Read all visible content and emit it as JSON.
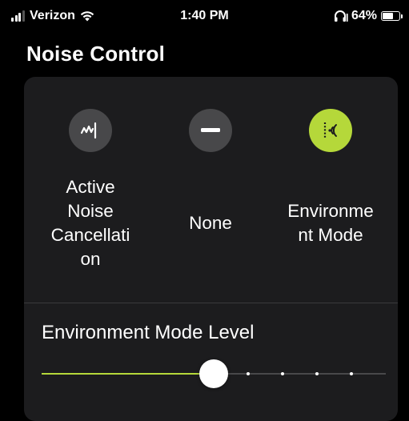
{
  "status_bar": {
    "carrier": "Verizon",
    "time": "1:40 PM",
    "battery_percent": "64%",
    "battery_level": 0.64,
    "icons": [
      "signal-icon",
      "wifi-icon",
      "headphones-battery-icon",
      "battery-icon"
    ]
  },
  "page": {
    "title": "Noise Control"
  },
  "modes": [
    {
      "label": "Active\nNoise\nCancellati\non",
      "icon": "noise-cancellation-icon",
      "selected": false
    },
    {
      "label": "None",
      "icon": "minus-icon",
      "selected": false
    },
    {
      "label": "Environme\nnt Mode",
      "icon": "environment-mode-icon",
      "selected": true
    }
  ],
  "level": {
    "title": "Environment Mode Level",
    "value_fraction": 0.5,
    "steps": 5
  },
  "colors": {
    "background": "#000000",
    "card": "#1c1c1e",
    "accent": "#b5d83a",
    "inactive_circle": "#48484a"
  }
}
